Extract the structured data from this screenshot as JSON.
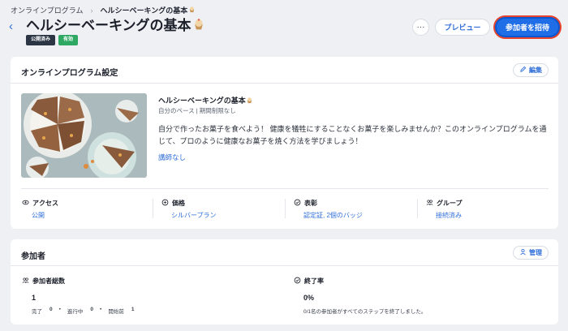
{
  "breadcrumb": {
    "parent": "オンラインプログラム",
    "current": "ヘルシーベーキングの基本"
  },
  "header": {
    "title": "ヘルシーベーキングの基本",
    "badges": [
      "公開済み",
      "有効"
    ],
    "more_label": "···",
    "preview_label": "プレビュー",
    "invite_label": "参加者を招待"
  },
  "settings": {
    "title": "オンラインプログラム設定",
    "edit_label": "編集",
    "program_name": "ヘルシーベーキングの基本",
    "meta": "自分のペース | 期間制限なし",
    "description": "自分で作ったお菓子を食べよう！ 健康を犠牲にすることなくお菓子を楽しみませんか？このオンラインプログラムを通じて、プロのように健康なお菓子を焼く方法を学びましょう！",
    "instructor": "講師なし",
    "stats": [
      {
        "label": "アクセス",
        "value": "公開",
        "icon": "eye-icon"
      },
      {
        "label": "価格",
        "value": "シルバープラン",
        "icon": "price-tag-icon"
      },
      {
        "label": "表彰",
        "value": "認定証, 2個のバッジ",
        "icon": "check-circle-icon"
      },
      {
        "label": "グループ",
        "value": "接続済み",
        "icon": "group-icon"
      }
    ]
  },
  "participants": {
    "title": "参加者",
    "manage_label": "管理",
    "total_label": "参加者総数",
    "total_value": "1",
    "breakdown": [
      {
        "label": "完了",
        "value": "0"
      },
      {
        "label": "進行中",
        "value": "0"
      },
      {
        "label": "開始前",
        "value": "1"
      }
    ],
    "completion_label": "終了率",
    "completion_value": "0%",
    "completion_note": "0/1名の参加者がすべてのステップを終了しました。"
  },
  "colors": {
    "accent": "#1f6ee8",
    "published_badge": "#2c3544",
    "active_badge": "#2ea863",
    "page_bg": "#eef0f4"
  }
}
